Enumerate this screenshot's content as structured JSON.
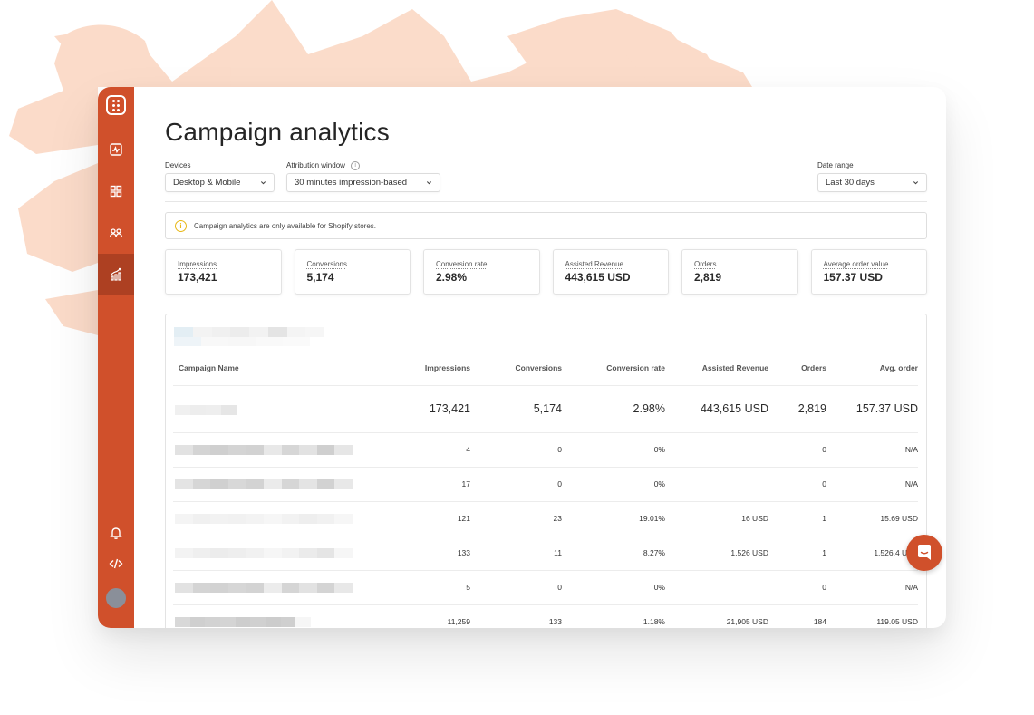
{
  "app": {
    "accent_color": "#d0502b",
    "accent_active_color": "#ad4022"
  },
  "sidebar": {
    "items": [
      {
        "name": "logo",
        "icon": "app-logo-icon",
        "active": false
      },
      {
        "name": "dashboard",
        "icon": "activity-chart-icon",
        "active": false
      },
      {
        "name": "campaigns",
        "icon": "grid-icon",
        "active": false
      },
      {
        "name": "subscribers",
        "icon": "users-icon",
        "active": false
      },
      {
        "name": "analytics",
        "icon": "bar-chart-growth-icon",
        "active": true
      }
    ],
    "bottom_items": [
      {
        "name": "notifications",
        "icon": "bell-icon"
      },
      {
        "name": "embed-code",
        "icon": "code-icon"
      },
      {
        "name": "profile",
        "icon": "avatar"
      }
    ]
  },
  "header": {
    "title": "Campaign analytics"
  },
  "filters": {
    "devices": {
      "label": "Devices",
      "value": "Desktop & Mobile"
    },
    "attribution": {
      "label": "Attribution window",
      "value": "30 minutes impression-based",
      "info_icon": "i"
    },
    "date_range": {
      "label": "Date range",
      "value": "Last 30 days"
    }
  },
  "notice": {
    "icon": "i",
    "text": "Campaign analytics are only available for Shopify stores."
  },
  "summary_cards": [
    {
      "label": "Impressions",
      "value": "173,421"
    },
    {
      "label": "Conversions",
      "value": "5,174"
    },
    {
      "label": "Conversion rate",
      "value": "2.98%"
    },
    {
      "label": "Assisted Revenue",
      "value": "443,615 USD"
    },
    {
      "label": "Orders",
      "value": "2,819"
    },
    {
      "label": "Average order value",
      "value": "157.37 USD"
    }
  ],
  "table": {
    "columns": [
      "Campaign Name",
      "Impressions",
      "Conversions",
      "Conversion rate",
      "Assisted Revenue",
      "Orders",
      "Avg. order"
    ],
    "total_row": {
      "name": "",
      "impressions": "173,421",
      "conversions": "5,174",
      "rate": "2.98%",
      "revenue": "443,615 USD",
      "orders": "2,819",
      "aov": "157.37 USD"
    },
    "rows": [
      {
        "name": "",
        "impressions": "4",
        "conversions": "0",
        "rate": "0%",
        "revenue": "",
        "orders": "0",
        "aov": "N/A"
      },
      {
        "name": "",
        "impressions": "17",
        "conversions": "0",
        "rate": "0%",
        "revenue": "",
        "orders": "0",
        "aov": "N/A"
      },
      {
        "name": "",
        "impressions": "121",
        "conversions": "23",
        "rate": "19.01%",
        "revenue": "16 USD",
        "orders": "1",
        "aov": "15.69 USD"
      },
      {
        "name": "",
        "impressions": "133",
        "conversions": "11",
        "rate": "8.27%",
        "revenue": "1,526 USD",
        "orders": "1",
        "aov": "1,526.4 USD"
      },
      {
        "name": "",
        "impressions": "5",
        "conversions": "0",
        "rate": "0%",
        "revenue": "",
        "orders": "0",
        "aov": "N/A"
      },
      {
        "name": "",
        "impressions": "11,259",
        "conversions": "133",
        "rate": "1.18%",
        "revenue": "21,905 USD",
        "orders": "184",
        "aov": "119.05 USD"
      }
    ]
  },
  "chat": {
    "icon": "chat-bubble-icon"
  }
}
